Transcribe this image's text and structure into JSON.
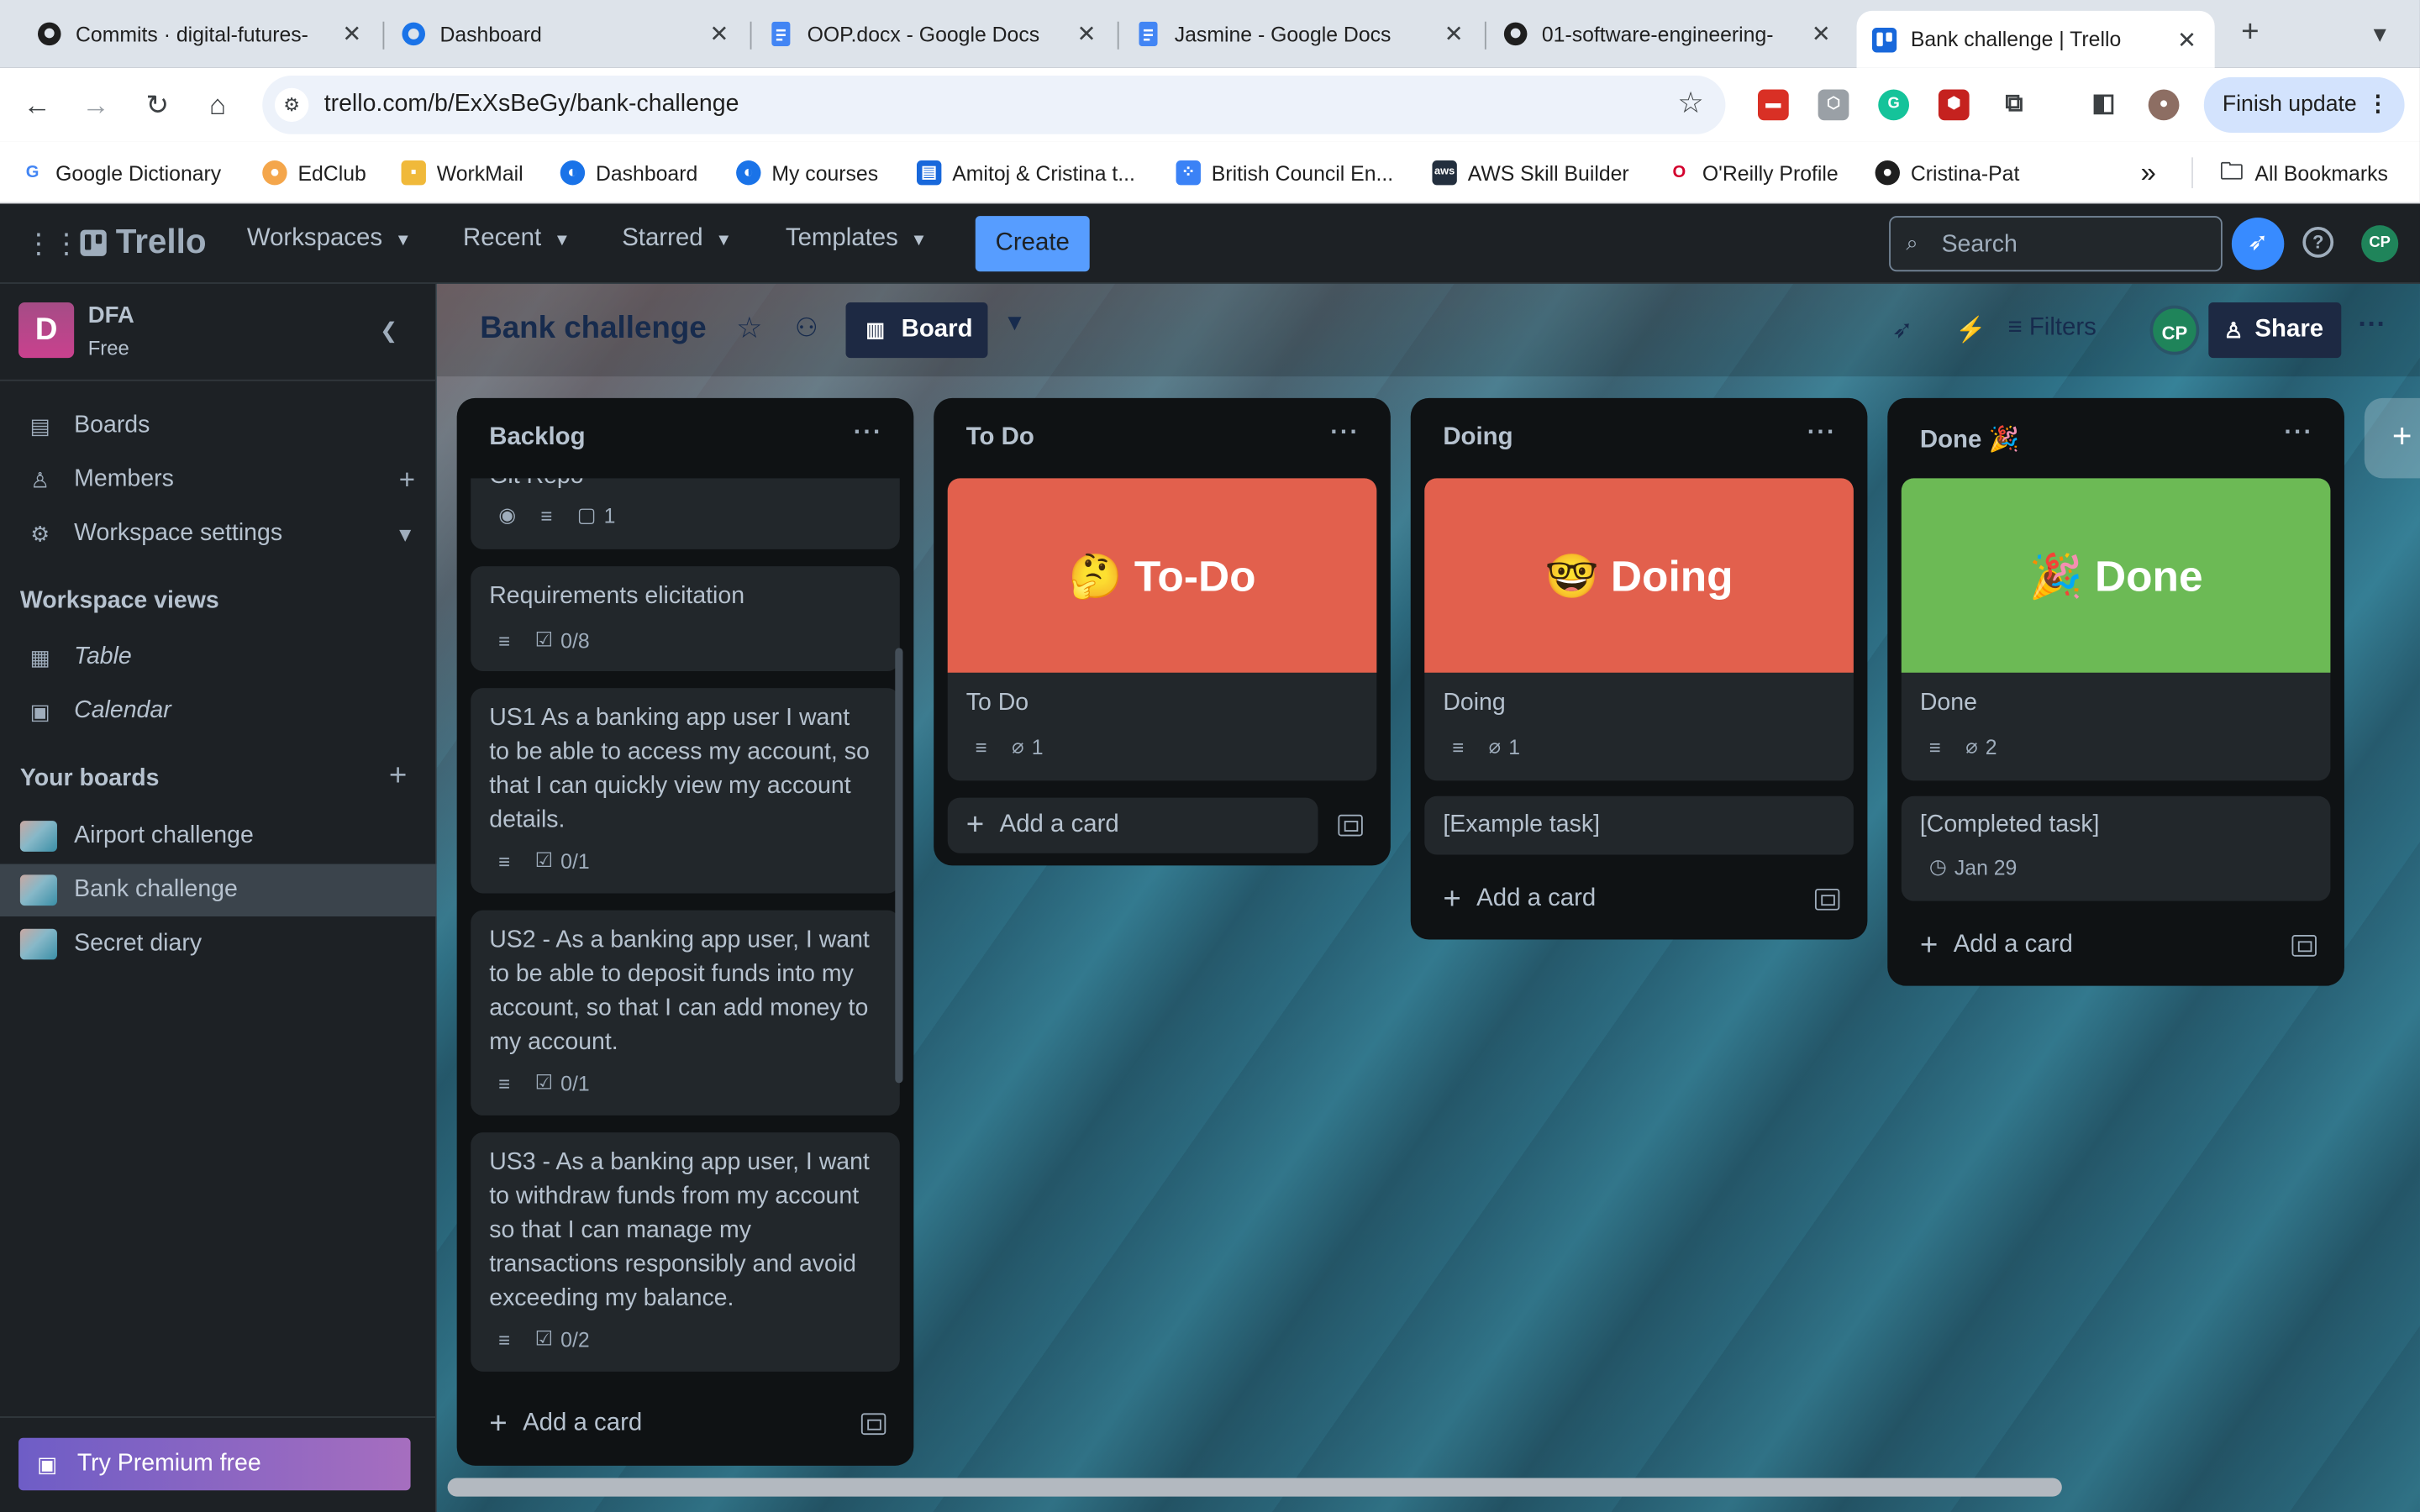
{
  "browser": {
    "tabs": [
      {
        "title": "Commits · digital-futures-",
        "icon": "github-icon"
      },
      {
        "title": "Dashboard",
        "icon": "moodle-icon"
      },
      {
        "title": "OOP.docx - Google Docs",
        "icon": "google-docs-icon"
      },
      {
        "title": "Jasmine - Google Docs",
        "icon": "google-docs-icon"
      },
      {
        "title": "01-software-engineering-",
        "icon": "github-icon"
      },
      {
        "title": "Bank challenge | Trello",
        "icon": "trello-icon",
        "active": true
      }
    ],
    "close_glyph": "✕",
    "new_tab_glyph": "+",
    "url": "trello.com/b/ExXsBeGy/bank-challenge",
    "finish_update": "Finish update",
    "bookmarks": [
      {
        "label": "Google Dictionary",
        "icon": "google-icon"
      },
      {
        "label": "EdClub",
        "icon": "edclub-icon"
      },
      {
        "label": "WorkMail",
        "icon": "workmail-icon"
      },
      {
        "label": "Dashboard",
        "icon": "moodle-icon"
      },
      {
        "label": "My courses",
        "icon": "moodle-icon"
      },
      {
        "label": "Amitoj & Cristina t...",
        "icon": "doc-icon"
      },
      {
        "label": "British Council En...",
        "icon": "british-council-icon"
      },
      {
        "label": "AWS Skill Builder",
        "icon": "aws-icon"
      },
      {
        "label": "O'Reilly Profile",
        "icon": "oreilly-icon"
      },
      {
        "label": "Cristina-Pat",
        "icon": "github-icon"
      }
    ],
    "more_bookmarks": "»",
    "all_bookmarks": "All Bookmarks"
  },
  "header": {
    "logo": "Trello",
    "nav": [
      "Workspaces",
      "Recent",
      "Starred",
      "Templates"
    ],
    "create": "Create",
    "search_placeholder": "Search",
    "user_initials": "CP"
  },
  "sidebar": {
    "workspace_initial": "D",
    "workspace_name": "DFA",
    "workspace_plan": "Free",
    "items": [
      {
        "label": "Boards",
        "icon": "boards-icon"
      },
      {
        "label": "Members",
        "icon": "member-icon"
      },
      {
        "label": "Workspace settings",
        "icon": "gear-icon"
      }
    ],
    "views_heading": "Workspace views",
    "views": [
      {
        "label": "Table",
        "icon": "table-icon"
      },
      {
        "label": "Calendar",
        "icon": "calendar-icon"
      }
    ],
    "boards_heading": "Your boards",
    "boards": [
      {
        "label": "Airport challenge"
      },
      {
        "label": "Bank challenge",
        "active": true
      },
      {
        "label": "Secret diary"
      }
    ],
    "premium": "Try Premium free"
  },
  "board": {
    "title": "Bank challenge",
    "view": "Board",
    "filters": "Filters",
    "member_initials": "CP",
    "share": "Share",
    "lists": [
      {
        "name": "Backlog",
        "cards": [
          {
            "title": "Git Repo",
            "badges": {
              "comments": "1"
            }
          },
          {
            "title": "Requirements elicitation",
            "badges": {
              "checklist": "0/8"
            }
          },
          {
            "title": "US1 As a banking app user I want to be able to access my account, so that I can quickly view my account details.",
            "badges": {
              "checklist": "0/1"
            }
          },
          {
            "title": "US2 - As a banking app user, I want to be able to deposit funds into my account, so that I can add money to my account.",
            "badges": {
              "checklist": "0/1"
            }
          },
          {
            "title": "US3 - As a banking app user, I want to withdraw funds from my account so that I can manage my transactions responsibly and avoid exceeding my balance.",
            "badges": {
              "checklist": "0/2"
            }
          }
        ],
        "add_card": "Add a card"
      },
      {
        "name": "To Do",
        "cover_text": "🤔 To-Do",
        "cover_color": "#e2604d",
        "cards": [
          {
            "title": "To Do",
            "badges": {
              "attachments": "1"
            }
          }
        ],
        "add_card": "Add a card"
      },
      {
        "name": "Doing",
        "cover_text": "🤓 Doing",
        "cover_color": "#e2604d",
        "cards": [
          {
            "title": "Doing",
            "badges": {
              "attachments": "1"
            }
          },
          {
            "title": "[Example task]"
          }
        ],
        "add_card": "Add a card"
      },
      {
        "name": "Done 🎉",
        "cover_text": "🎉 Done",
        "cover_color": "#6cba55",
        "cards": [
          {
            "title": "Done",
            "badges": {
              "attachments": "2"
            }
          },
          {
            "title": "[Completed task]",
            "badges": {
              "due": "Jan 29"
            }
          }
        ],
        "add_card": "Add a card"
      }
    ]
  }
}
